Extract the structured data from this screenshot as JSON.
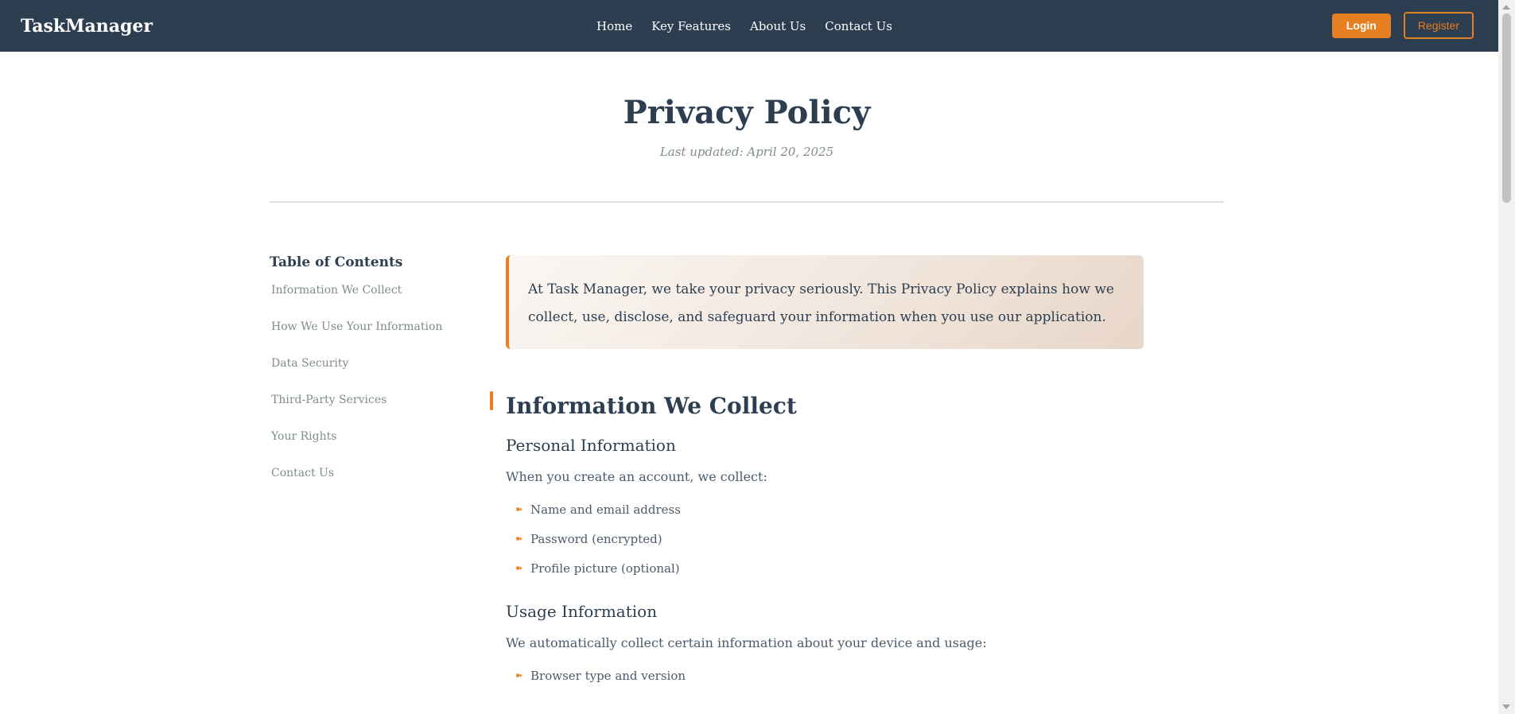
{
  "header": {
    "brand": "TaskManager",
    "nav": [
      "Home",
      "Key Features",
      "About Us",
      "Contact Us"
    ],
    "login_label": "Login",
    "register_label": "Register"
  },
  "page": {
    "title": "Privacy Policy",
    "last_updated": "Last updated: April 20, 2025"
  },
  "toc": {
    "title": "Table of Contents",
    "items": [
      "Information We Collect",
      "How We Use Your Information",
      "Data Security",
      "Third-Party Services",
      "Your Rights",
      "Contact Us"
    ]
  },
  "intro": "At Task Manager, we take your privacy seriously. This Privacy Policy explains how we collect, use, disclose, and safeguard your information when you use our application.",
  "sections": {
    "collect": {
      "heading": "Information We Collect",
      "personal": {
        "heading": "Personal Information",
        "text": "When you create an account, we collect:",
        "items": [
          "Name and email address",
          "Password (encrypted)",
          "Profile picture (optional)"
        ]
      },
      "usage": {
        "heading": "Usage Information",
        "text": "We automatically collect certain information about your device and usage:",
        "items": [
          "Browser type and version"
        ]
      }
    }
  },
  "colors": {
    "nav_bg": "#2c3e50",
    "accent": "#e67e22",
    "muted_text": "#7f8c8d"
  },
  "icons": {
    "bullet": "arrow-bullet-icon",
    "bullet_glyph": "➽"
  }
}
